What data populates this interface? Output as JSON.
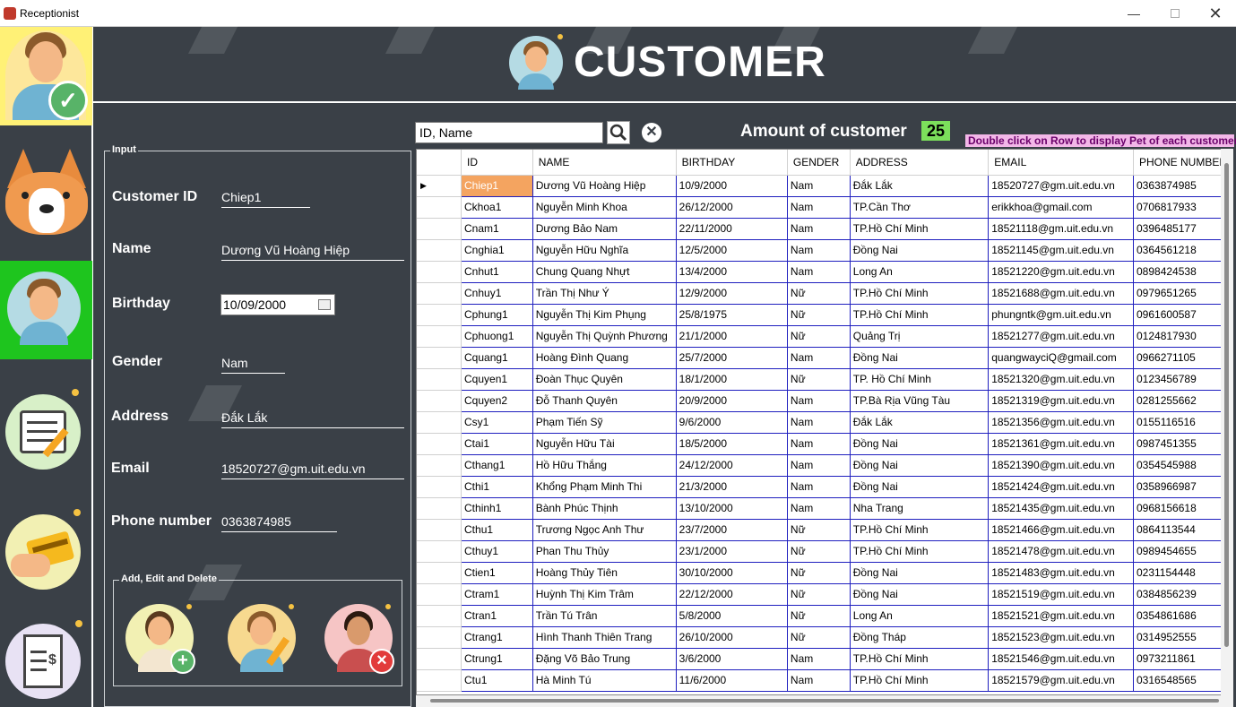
{
  "window": {
    "title": "Receptionist",
    "minimize": "—",
    "close": "✕"
  },
  "sidebar": {
    "items": [
      {
        "name": "receptionist-profile",
        "icon": "person-check-icon",
        "active": false
      },
      {
        "name": "pets",
        "icon": "corgi-icon",
        "active": false
      },
      {
        "name": "customer",
        "icon": "person-icon",
        "active": true
      },
      {
        "name": "booking",
        "icon": "checklist-icon",
        "active": false
      },
      {
        "name": "payment",
        "icon": "credit-card-icon",
        "active": false
      },
      {
        "name": "invoice",
        "icon": "receipt-icon",
        "active": false
      }
    ]
  },
  "header": {
    "title": "CUSTOMER"
  },
  "input": {
    "legend": "Input",
    "customer_id_label": "Customer ID",
    "customer_id_value": "Chiep1",
    "name_label": "Name",
    "name_value": "Dương Vũ Hoàng Hiệp",
    "birthday_label": "Birthday",
    "birthday_value": "10/09/2000",
    "gender_label": "Gender",
    "gender_value": "Nam",
    "address_label": "Address",
    "address_value": "Đắk Lắk",
    "email_label": "Email",
    "email_value": "18520727@gm.uit.edu.vn",
    "phone_label": "Phone number",
    "phone_value": "0363874985"
  },
  "actions": {
    "legend": "Add, Edit and Delete",
    "add": "+",
    "delete": "×"
  },
  "search": {
    "placeholder": "ID, Name",
    "value": "ID, Name",
    "clear": "✕"
  },
  "amount": {
    "label": "Amount of customer",
    "value": "25"
  },
  "hint": "Double click on Row to display Pet of each customer",
  "table": {
    "columns": [
      "ID",
      "NAME",
      "BIRTHDAY",
      "GENDER",
      "ADDRESS",
      "EMAIL",
      "PHONE NUMBER"
    ],
    "selected_row": 0,
    "rows": [
      [
        "Chiep1",
        "Dương Vũ Hoàng Hiệp",
        "10/9/2000",
        "Nam",
        "Đắk Lắk",
        "18520727@gm.uit.edu.vn",
        "0363874985"
      ],
      [
        "Ckhoa1",
        "Nguyễn Minh Khoa",
        "26/12/2000",
        "Nam",
        "TP.Cần Thơ",
        "erikkhoa@gmail.com",
        "0706817933"
      ],
      [
        "Cnam1",
        "Dương Bảo Nam",
        "22/11/2000",
        "Nam",
        "TP.Hồ Chí Minh",
        "18521118@gm.uit.edu.vn",
        "0396485177"
      ],
      [
        "Cnghia1",
        "Nguyễn Hữu Nghĩa",
        "12/5/2000",
        "Nam",
        "Đồng Nai",
        "18521145@gm.uit.edu.vn",
        "0364561218"
      ],
      [
        "Cnhut1",
        "Chung Quang Nhựt",
        "13/4/2000",
        "Nam",
        "Long An",
        "18521220@gm.uit.edu.vn",
        "0898424538"
      ],
      [
        "Cnhuy1",
        "Trần Thị Như Ý",
        "12/9/2000",
        "Nữ",
        "TP.Hồ Chí Minh",
        "18521688@gm.uit.edu.vn",
        "0979651265"
      ],
      [
        "Cphung1",
        "Nguyễn Thị Kim Phụng",
        "25/8/1975",
        "Nữ",
        "TP.Hồ Chí Minh",
        "phungntk@gm.uit.edu.vn",
        "0961600587"
      ],
      [
        "Cphuong1",
        "Nguyễn Thị Quỳnh Phương",
        "21/1/2000",
        "Nữ",
        "Quảng Trị",
        "18521277@gm.uit.edu.vn",
        "0124817930"
      ],
      [
        "Cquang1",
        "Hoàng Đình Quang",
        "25/7/2000",
        "Nam",
        "Đồng Nai",
        "quangwayciQ@gmail.com",
        "0966271105"
      ],
      [
        "Cquyen1",
        "Đoàn Thục Quyên",
        "18/1/2000",
        "Nữ",
        "TP. Hồ Chí Minh",
        "18521320@gm.uit.edu.vn",
        "0123456789"
      ],
      [
        "Cquyen2",
        "Đỗ Thanh Quyên",
        "20/9/2000",
        "Nam",
        "TP.Bà Rịa Vũng Tàu",
        "18521319@gm.uit.edu.vn",
        "0281255662"
      ],
      [
        "Csy1",
        "Phạm Tiến Sỹ",
        "9/6/2000",
        "Nam",
        "Đắk Lắk",
        "18521356@gm.uit.edu.vn",
        "0155116516"
      ],
      [
        "Ctai1",
        "Nguyễn Hữu Tài",
        "18/5/2000",
        "Nam",
        "Đồng Nai",
        "18521361@gm.uit.edu.vn",
        "0987451355"
      ],
      [
        "Cthang1",
        "Hồ Hữu Thắng",
        "24/12/2000",
        "Nam",
        "Đồng Nai",
        "18521390@gm.uit.edu.vn",
        "0354545988"
      ],
      [
        "Cthi1",
        "Khổng Phạm Minh Thi",
        "21/3/2000",
        "Nam",
        "Đồng Nai",
        "18521424@gm.uit.edu.vn",
        "0358966987"
      ],
      [
        "Cthinh1",
        "Bành Phúc Thịnh",
        "13/10/2000",
        "Nam",
        "Nha Trang",
        "18521435@gm.uit.edu.vn",
        "0968156618"
      ],
      [
        "Cthu1",
        "Trương Ngọc Anh Thư",
        "23/7/2000",
        "Nữ",
        "TP.Hồ Chí Minh",
        "18521466@gm.uit.edu.vn",
        "0864113544"
      ],
      [
        "Cthuy1",
        "Phan Thu Thủy",
        "23/1/2000",
        "Nữ",
        "TP.Hồ Chí Minh",
        "18521478@gm.uit.edu.vn",
        "0989454655"
      ],
      [
        "Ctien1",
        "Hoàng Thủy Tiên",
        "30/10/2000",
        "Nữ",
        "Đồng Nai",
        "18521483@gm.uit.edu.vn",
        "0231154448"
      ],
      [
        "Ctram1",
        "Huỳnh Thị Kim Trâm",
        "22/12/2000",
        "Nữ",
        "Đồng Nai",
        "18521519@gm.uit.edu.vn",
        "0384856239"
      ],
      [
        "Ctran1",
        "Trần Tú Trân",
        "5/8/2000",
        "Nữ",
        "Long An",
        "18521521@gm.uit.edu.vn",
        "0354861686"
      ],
      [
        "Ctrang1",
        "Hình Thanh Thiên Trang",
        "26/10/2000",
        "Nữ",
        "Đồng Tháp",
        "18521523@gm.uit.edu.vn",
        "0314952555"
      ],
      [
        "Ctrung1",
        "Đặng Võ Bảo Trung",
        "3/6/2000",
        "Nam",
        "TP.Hồ Chí Minh",
        "18521546@gm.uit.edu.vn",
        "0973211861"
      ],
      [
        "Ctu1",
        "Hà Minh Tú",
        "11/6/2000",
        "Nam",
        "TP.Hồ Chí Minh",
        "18521579@gm.uit.edu.vn",
        "0316548565"
      ]
    ]
  },
  "colors": {
    "background": "#3a4047",
    "active_sidebar": "#1ec51e",
    "profile_sidebar": "#fff176",
    "selected_cell": "#f4a460",
    "grid_lines": "#1f1fbf",
    "amount_bg": "#7ce05b",
    "hint_bg": "#f3b7e8"
  }
}
